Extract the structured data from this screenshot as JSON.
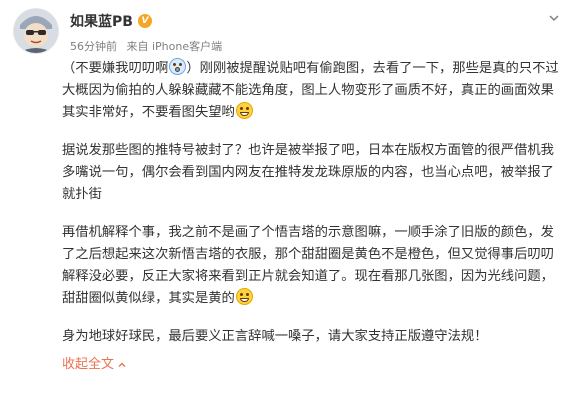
{
  "post": {
    "author": "如果蓝PB",
    "vip_badge": "V",
    "time": "56分钟前",
    "source": "来自 iPhone客户端",
    "paragraphs": {
      "p1a": "（不要嫌我叨叨啊",
      "p1b": "）刚刚被提醒说贴吧有偷跑图，去看了一下，那些是真的只不过大概因为偷拍的人躲躲藏藏不能选角度，图上人物变形了画质不好，真正的画面效果其实非常好，不要看图失望哟",
      "p2": "据说发那些图的推特号被封了？也许是被举报了吧，日本在版权方面管的很严借机我多嘴说一句，偶尔会看到国内网友在推特发龙珠原版的内容，也当心点吧，被举报了就扑街",
      "p3": "再借机解释个事，我之前不是画了个悟吉塔的示意图嘛，一顺手涂了旧版的颜色，发了之后想起来这次新悟吉塔的衣服，那个甜甜圈是黄色不是橙色，但又觉得事后叨叨解释没必要，反正大家将来看到正片就会知道了。现在看那几张图，因为光线问题，甜甜圈似黄似绿，其实是黄的",
      "p4": "身为地球好球民，最后要义正言辞喊一嗓子，请大家支持正版遵守法规！"
    },
    "collapse_label": "收起全文"
  },
  "icons": {
    "emoji_shy": "embarrassed-emoji",
    "emoji_grin": "grin-emoji",
    "chevron": "chevron-down-icon"
  },
  "colors": {
    "link": "#eb7350",
    "meta": "#808080",
    "text": "#333333"
  }
}
